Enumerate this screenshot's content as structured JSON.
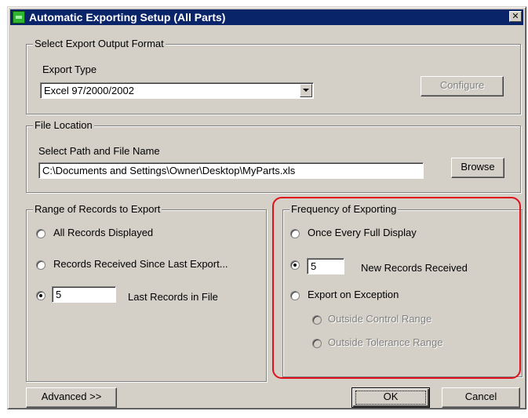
{
  "window": {
    "title": "Automatic Exporting Setup (All Parts)",
    "close_glyph": "✕"
  },
  "export_format": {
    "legend": "Select Export Output Format",
    "export_type_label": "Export Type",
    "export_type_value": "Excel 97/2000/2002",
    "configure_label": "Configure"
  },
  "file_location": {
    "legend": "File Location",
    "path_label": "Select Path and File Name",
    "path_value": "C:\\Documents and Settings\\Owner\\Desktop\\MyParts.xls",
    "browse_label": "Browse"
  },
  "range": {
    "legend": "Range of Records to Export",
    "option_all": "All Records Displayed",
    "option_since": "Records Received Since Last Export...",
    "last_count": "5",
    "option_last": "Last Records in File",
    "selected": "last"
  },
  "frequency": {
    "legend": "Frequency of Exporting",
    "option_full": "Once Every Full Display",
    "new_count": "5",
    "option_new": "New Records Received",
    "option_exception": "Export on Exception",
    "sub_control": "Outside Control Range",
    "sub_tolerance": "Outside Tolerance Range",
    "selected": "new"
  },
  "buttons": {
    "advanced": "Advanced >>",
    "ok": "OK",
    "cancel": "Cancel"
  },
  "colors": {
    "title_bar": "#0a246a",
    "dialog_bg": "#d4d0c8",
    "highlight": "#e0101a"
  }
}
